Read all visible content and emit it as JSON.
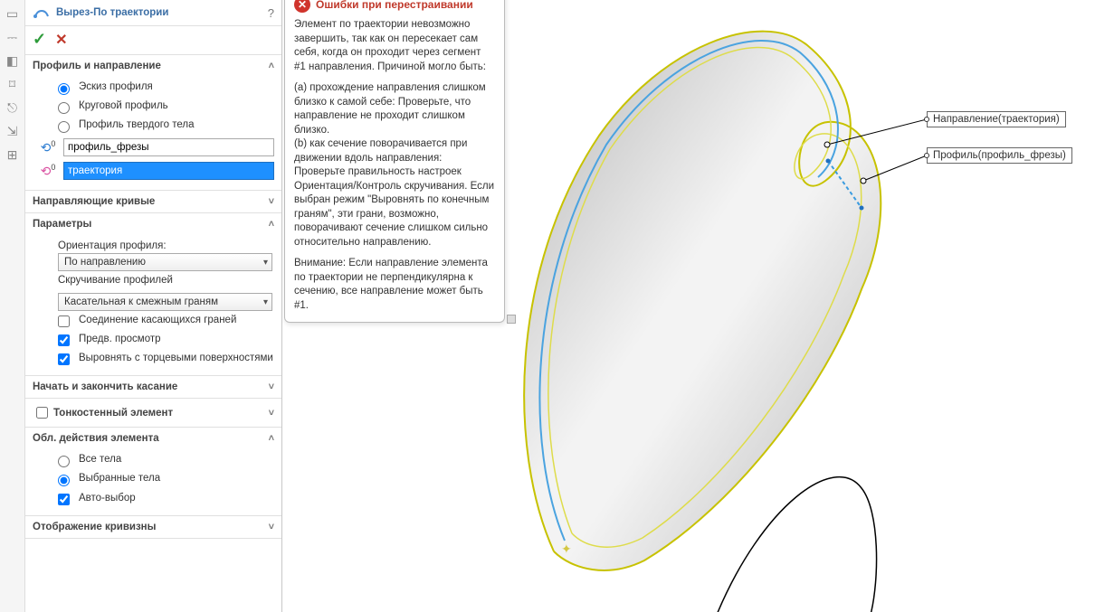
{
  "feature": {
    "title": "Вырез-По траектории"
  },
  "sections": {
    "profile_dir": {
      "title": "Профиль и направление",
      "radios": {
        "sketch": "Эскиз профиля",
        "circular": "Круговой профиль",
        "solid": "Профиль твердого тела"
      },
      "profile_input": "профиль_фрезы",
      "path_input": "траектория"
    },
    "guide_curves": {
      "title": "Направляющие кривые"
    },
    "params": {
      "title": "Параметры",
      "orientation_label": "Ориентация профиля:",
      "orientation_value": "По направлению",
      "twist_label": "Скручивание профилей",
      "twist_value": "Касательная к смежным граням",
      "merge_tangent": "Соединение касающихся граней",
      "preview": "Предв. просмотр",
      "align_end": "Выровнять с торцевыми поверхностями"
    },
    "start_end": {
      "title": "Начать и закончить касание"
    },
    "thin": {
      "title": "Тонкостенный элемент"
    },
    "scope": {
      "title": "Обл. действия элемента",
      "all_bodies": "Все тела",
      "selected_bodies": "Выбранные тела",
      "auto_select": "Авто-выбор"
    },
    "curvature": {
      "title": "Отображение кривизны"
    }
  },
  "error": {
    "title": "Ошибки при перестраивании",
    "p1": "Элемент по траектории невозможно завершить, так как он пересекает сам себя, когда он проходит через сегмент #1 направления.   Причиной могло быть:",
    "p2": "(а) прохождение направления слишком близко к самой себе: Проверьте, что направление не проходит слишком близко.",
    "p3": "(b) как сечение поворачивается при движении вдоль направления: Проверьте правильность настроек Ориентация/Контроль скручивания. Если выбран режим \"Выровнять по конечным граням\", эти грани, возможно, поворачивают сечение слишком сильно относительно направлению.",
    "p4": "Внимание: Если направление элемента по траектории не перпендикулярна к сечению, все направление может быть #1."
  },
  "callouts": {
    "direction": "Направление(траектория)",
    "profile": "Профиль(профиль_фрезы)"
  }
}
